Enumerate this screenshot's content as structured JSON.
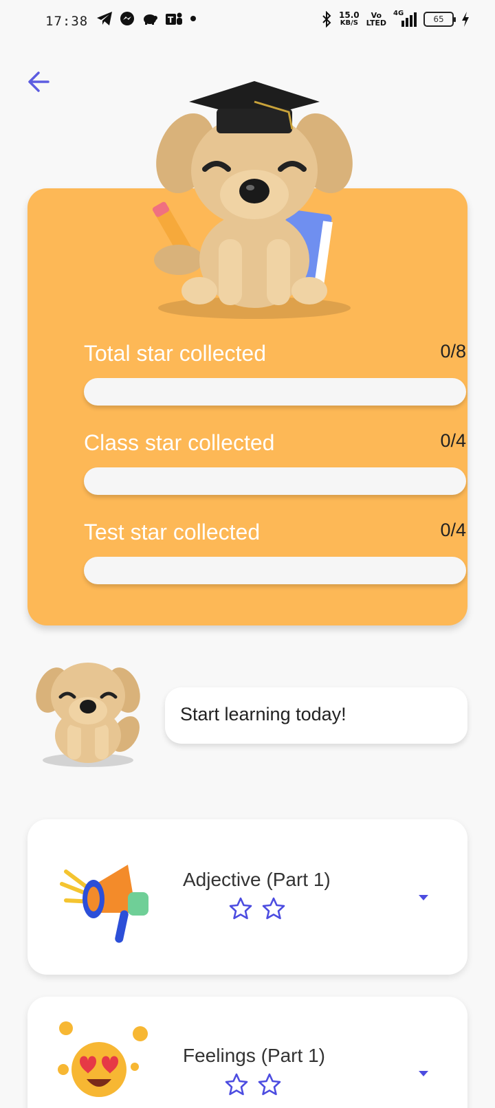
{
  "status_bar": {
    "time": "17:38",
    "net_speed_value": "15.0",
    "net_speed_unit": "KB/S",
    "volte_line1": "Vo",
    "volte_line2": "LTED",
    "network": "4G",
    "battery": "65",
    "left_icons": [
      "telegram-icon",
      "messenger-icon",
      "piggy-bank-icon",
      "teams-icon",
      "dot-icon"
    ],
    "right_icons": [
      "bluetooth-icon",
      "signal-icon",
      "battery-icon",
      "charging-icon"
    ]
  },
  "header": {
    "back_icon": "arrow-left-icon",
    "accent": "#5c5ce0"
  },
  "progress_card": {
    "bg_color": "#fdb856",
    "rows": [
      {
        "label": "Total star collected",
        "value": "0/8",
        "progress": 0.0
      },
      {
        "label": "Class star collected",
        "value": "0/4",
        "progress": 0.0
      },
      {
        "label": "Test star collected",
        "value": "0/4",
        "progress": 0.0
      }
    ]
  },
  "encouragement": {
    "text": "Start learning today!"
  },
  "lessons": [
    {
      "title": "Adjective (Part 1)",
      "icon": "megaphone-icon",
      "stars_total": 2,
      "stars_earned": 0
    },
    {
      "title": "Feelings (Part 1)",
      "icon": "heart-eyes-emoji-icon",
      "stars_total": 2,
      "stars_earned": 0
    }
  ]
}
